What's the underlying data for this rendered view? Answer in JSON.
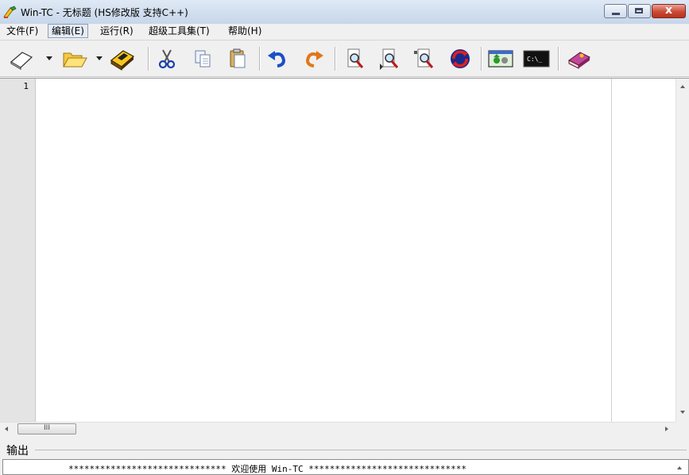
{
  "window": {
    "title": "Win-TC - 无标题 (HS修改版 支持C++)",
    "close_glyph": "x",
    "icon": "win-tc-app-icon"
  },
  "menu": {
    "items": [
      "文件(F)",
      "编辑(E)",
      "运行(R)",
      "超级工具集(T)",
      "帮助(H)"
    ],
    "active_index": 1
  },
  "toolbar": {
    "buttons": [
      "new-file-icon",
      "open-folder-icon",
      "save-icon",
      "cut-icon",
      "copy-icon",
      "paste-icon",
      "undo-icon",
      "redo-icon",
      "find-icon",
      "find-next-icon",
      "replace-icon",
      "refresh-icon",
      "compile-icon",
      "console-icon",
      "help-book-icon"
    ],
    "console_glyph": "C:\\_"
  },
  "editor": {
    "line_numbers": [
      "1"
    ],
    "content": ""
  },
  "hscroll": {
    "grip": "III"
  },
  "output": {
    "label": "输出",
    "text": "****************************** 欢迎使用 Win-TC ******************************"
  },
  "colors": {
    "titlebar": "#c6d6ea",
    "close_button": "#c94a35",
    "gutter": "#e4e4e4"
  }
}
